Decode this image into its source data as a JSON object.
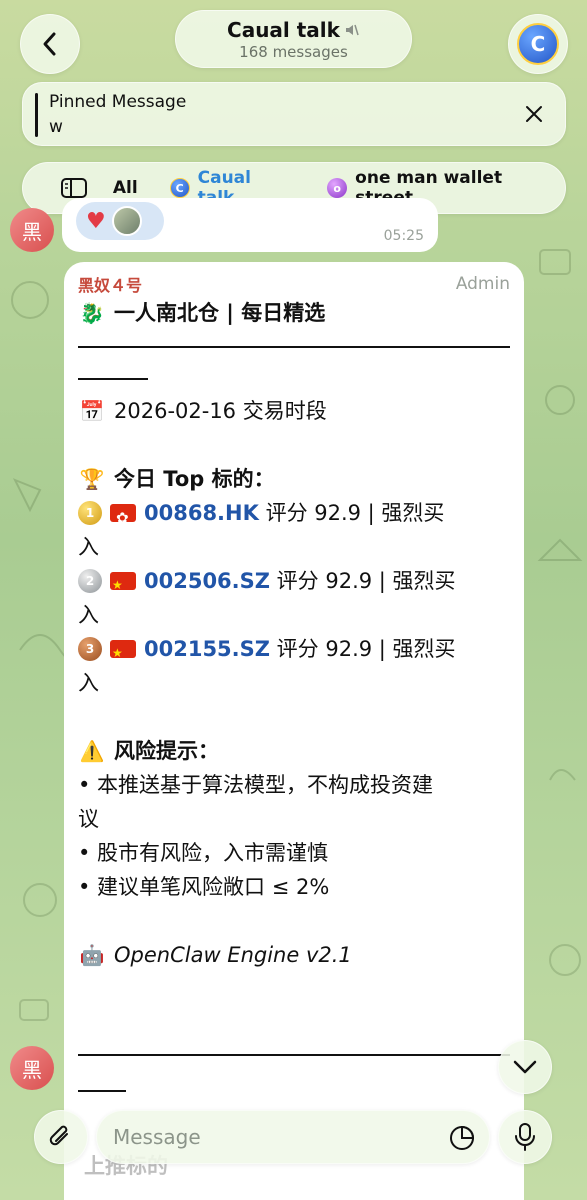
{
  "header": {
    "title": "Caual talk",
    "muted_icon": "muted-speaker-icon",
    "subtitle": "168 messages",
    "back_icon": "chevron-left-icon",
    "avatar_letter": "C"
  },
  "pinned": {
    "title": "Pinned Message",
    "text": "w"
  },
  "tabs": {
    "all": "All",
    "cauai": "Caual talk",
    "cauai_icon_letter": "C",
    "wallet": "one man wallet street",
    "wallet_icon_letter": "o"
  },
  "prev_message": {
    "time": "05:25",
    "avatar_text": "黑"
  },
  "message": {
    "sender": "黑奴４号",
    "role": "Admin",
    "title_emoji": "🐉",
    "title": "一人南北仓 | 每日精选",
    "date_emoji": "📅",
    "date_line": "2026-02-16 交易时段",
    "top_emoji": "🏆",
    "top_heading": "今日 Top 标的：",
    "picks": [
      {
        "medal": "1",
        "ticker": "00868.HK",
        "rest": " 评分 92.9 | 强烈买",
        "wrap": "入"
      },
      {
        "medal": "2",
        "ticker": "002506.SZ",
        "rest": " 评分 92.9 | 强烈买",
        "wrap": "入"
      },
      {
        "medal": "3",
        "ticker": "002155.SZ",
        "rest": " 评分 92.9 | 强烈买",
        "wrap": "入"
      }
    ],
    "risk_emoji": "⚠️",
    "risk_heading": "风险提示：",
    "risk_lines": [
      "• 本推送基于算法模型，不构成投资建",
      "议",
      "• 股市有风险，入市需谨慎",
      "• 建议单笔风险敞口 ≤ 2%"
    ],
    "engine_emoji": "🤖",
    "engine": "OpenClaw Engine v2.1"
  },
  "side_avatar_text": "黑",
  "composer": {
    "placeholder": "Message"
  },
  "ghost_text": "上推标的",
  "colors": {
    "accent": "#2f86d6",
    "link": "#2155a8",
    "sender": "#c64a3c"
  }
}
